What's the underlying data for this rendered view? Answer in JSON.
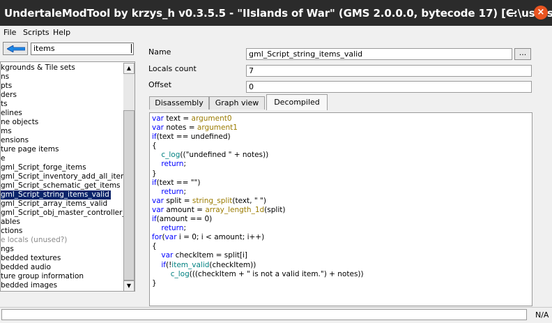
{
  "window": {
    "title": "UndertaleModTool by krzys_h v0.3.5.5 - \"IIslands of War\" (GMS 2.0.0.0, bytecode 17) [C:\\users\\s...",
    "close_glyph": "×"
  },
  "menu": {
    "file": "File",
    "scripts": "Scripts",
    "help": "Help"
  },
  "sidebar": {
    "search_value": "items",
    "items": [
      {
        "label": "kgrounds & Tile sets",
        "style": "normal"
      },
      {
        "label": "ns",
        "style": "normal"
      },
      {
        "label": "pts",
        "style": "normal"
      },
      {
        "label": "ders",
        "style": "normal"
      },
      {
        "label": "ts",
        "style": "normal"
      },
      {
        "label": "elines",
        "style": "normal"
      },
      {
        "label": "ne objects",
        "style": "normal"
      },
      {
        "label": "ms",
        "style": "normal"
      },
      {
        "label": "ensions",
        "style": "normal"
      },
      {
        "label": "ture page items",
        "style": "normal"
      },
      {
        "label": "e",
        "style": "normal"
      },
      {
        "label": "gml_Script_forge_items",
        "style": "normal"
      },
      {
        "label": "gml_Script_inventory_add_all_item",
        "style": "normal"
      },
      {
        "label": "gml_Script_schematic_get_items",
        "style": "normal"
      },
      {
        "label": "gml_Script_string_items_valid",
        "style": "selected"
      },
      {
        "label": "gml_Script_array_items_valid",
        "style": "normal"
      },
      {
        "label": "gml_Script_obj_master_controller_",
        "style": "normal"
      },
      {
        "label": "ables",
        "style": "normal"
      },
      {
        "label": "ctions",
        "style": "normal"
      },
      {
        "label": "e locals (unused?)",
        "style": "grey"
      },
      {
        "label": "ngs",
        "style": "normal"
      },
      {
        "label": "bedded textures",
        "style": "normal"
      },
      {
        "label": "bedded audio",
        "style": "normal"
      },
      {
        "label": "ture group information",
        "style": "normal"
      },
      {
        "label": "bedded images",
        "style": "normal"
      }
    ]
  },
  "details": {
    "name_label": "Name",
    "name_value": "gml_Script_string_items_valid",
    "name_button": "...",
    "locals_label": "Locals count",
    "locals_value": "7",
    "offset_label": "Offset",
    "offset_value": "0"
  },
  "tabs": {
    "disassembly": "Disassembly",
    "graph_view": "Graph view",
    "decompiled": "Decompiled",
    "active": "Decompiled"
  },
  "code_lines": [
    [
      [
        "kw",
        "var"
      ],
      [
        "",
        "text = "
      ],
      [
        "fn",
        "argument0"
      ]
    ],
    [
      [
        "kw",
        "var"
      ],
      [
        "",
        "notes = "
      ],
      [
        "fn",
        "argument1"
      ]
    ],
    [
      [
        "kw",
        "if"
      ],
      [
        "",
        "(text == undefined)"
      ]
    ],
    [
      [
        "",
        "{"
      ]
    ],
    [
      [
        "",
        "    "
      ],
      [
        "st",
        "c_log"
      ],
      [
        "",
        "((\"undefined \" + notes))"
      ]
    ],
    [
      [
        "",
        "    "
      ],
      [
        "kw",
        "return"
      ],
      [
        "",
        ";"
      ]
    ],
    [
      [
        "",
        "}"
      ]
    ],
    [
      [
        "kw",
        "if"
      ],
      [
        "",
        "(text == \"\")"
      ]
    ],
    [
      [
        "",
        "    "
      ],
      [
        "kw",
        "return"
      ],
      [
        "",
        ";"
      ]
    ],
    [
      [
        "kw",
        "var"
      ],
      [
        "",
        "split = "
      ],
      [
        "fn",
        "string_split"
      ],
      [
        "",
        "(text, \" \")"
      ]
    ],
    [
      [
        "kw",
        "var"
      ],
      [
        "",
        "amount = "
      ],
      [
        "fn",
        "array_length_1d"
      ],
      [
        "",
        "(split)"
      ]
    ],
    [
      [
        "kw",
        "if"
      ],
      [
        "",
        "(amount == 0)"
      ]
    ],
    [
      [
        "",
        "    "
      ],
      [
        "kw",
        "return"
      ],
      [
        "",
        ";"
      ]
    ],
    [
      [
        "kw",
        "for"
      ],
      [
        "",
        "("
      ],
      [
        "kw",
        "var"
      ],
      [
        "",
        ""
      ],
      [
        "",
        ""
      ],
      [
        "",
        "i = 0; i < amount; i++)"
      ]
    ],
    [
      [
        "",
        "{"
      ]
    ],
    [
      [
        "",
        "    "
      ],
      [
        "kw",
        "var"
      ],
      [
        "",
        "checkItem = split[i]"
      ]
    ],
    [
      [
        "",
        "    "
      ],
      [
        "kw",
        "if"
      ],
      [
        "",
        "(!"
      ],
      [
        "st",
        "item_valid"
      ],
      [
        "",
        "(checkItem))"
      ]
    ],
    [
      [
        "",
        "        "
      ],
      [
        "st",
        "c_log"
      ],
      [
        "",
        "(((checkItem + \" is not a valid item.\") + notes))"
      ]
    ],
    [
      [
        "",
        "}"
      ]
    ]
  ],
  "colors": {
    "keyword": "#0000ff",
    "function": "#9a7b00",
    "builtin": "#008080",
    "selection": "#0a246a",
    "titlebar": "#2b2b2b",
    "close": "#e95420"
  },
  "icons": {
    "back": "back-arrow-icon",
    "close": "close-icon",
    "minimize": "minimize-icon"
  },
  "status": {
    "text": "",
    "right": "N/A"
  }
}
